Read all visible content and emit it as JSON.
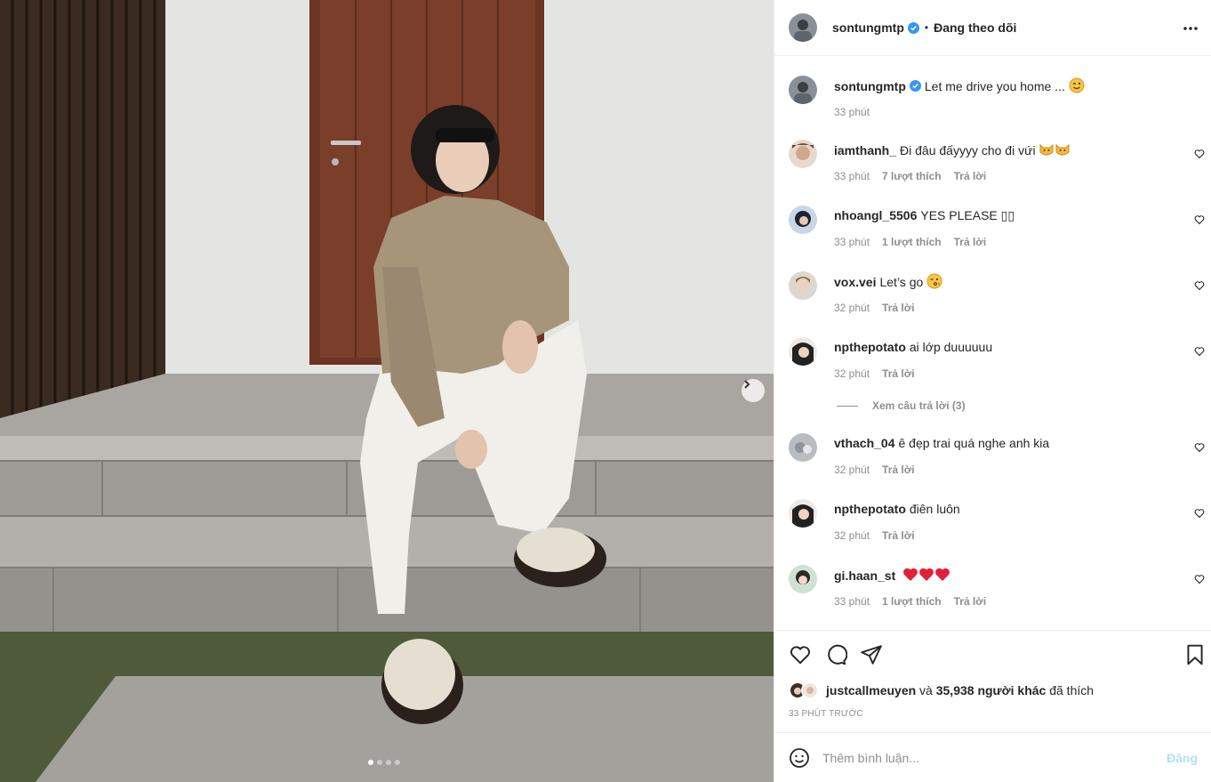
{
  "post": {
    "author": "sontungmtp",
    "follow_status": "Đang theo dõi",
    "separator": "•",
    "caption": "Let me drive you home ...",
    "caption_time": "33 phút",
    "carousel": {
      "count": 4,
      "active": 1
    }
  },
  "comments": [
    {
      "user": "iamthanh_",
      "text": "Đi đâu đấyyyy cho đi vứi",
      "emoji": "cat-faces",
      "time": "33 phút",
      "likes": "7 lượt thích",
      "reply": "Trả lời"
    },
    {
      "user": "nhoangl_5506",
      "text": "YES PLEASE ▯▯",
      "time": "33 phút",
      "likes": "1 lượt thích",
      "reply": "Trả lời"
    },
    {
      "user": "vox.vei",
      "text": "Let’s go",
      "emoji": "kissing-face",
      "time": "32 phút",
      "likes": "",
      "reply": "Trả lời"
    },
    {
      "user": "npthepotato",
      "text": "ai lớp duuuuuu",
      "time": "32 phút",
      "likes": "",
      "reply": "Trả lời"
    },
    {
      "user": "vthach_04",
      "text": "ê đẹp trai quá nghe anh kia",
      "time": "32 phút",
      "likes": "",
      "reply": "Trả lời"
    },
    {
      "user": "npthepotato",
      "text": "điên luôn",
      "time": "32 phút",
      "likes": "",
      "reply": "Trả lời"
    },
    {
      "user": "gi.haan_st",
      "text": "",
      "emoji": "red-hearts",
      "time": "33 phút",
      "likes": "1 lượt thích",
      "reply": "Trả lời"
    }
  ],
  "view_replies": "Xem câu trả lời (3)",
  "liked_by": {
    "user": "justcallmeuyen",
    "connector": "và",
    "others": "35,938 người khác",
    "suffix": "đã thích"
  },
  "posted_time": "33 PHÚT TRƯỚC",
  "comment_box": {
    "placeholder": "Thêm bình luận...",
    "post_label": "Đăng"
  },
  "icons": {
    "verified": "verified-badge-icon",
    "more": "more-horizontal-icon",
    "like": "heart-icon",
    "comment": "comment-bubble-icon",
    "share": "paper-plane-icon",
    "save": "bookmark-icon",
    "emoji": "smiley-icon",
    "next": "chevron-right-icon"
  },
  "colors": {
    "verified": "#3897f0",
    "heart": "#ed4956",
    "post_disabled": "#b2dffc",
    "meta": "#8e8e8e"
  }
}
